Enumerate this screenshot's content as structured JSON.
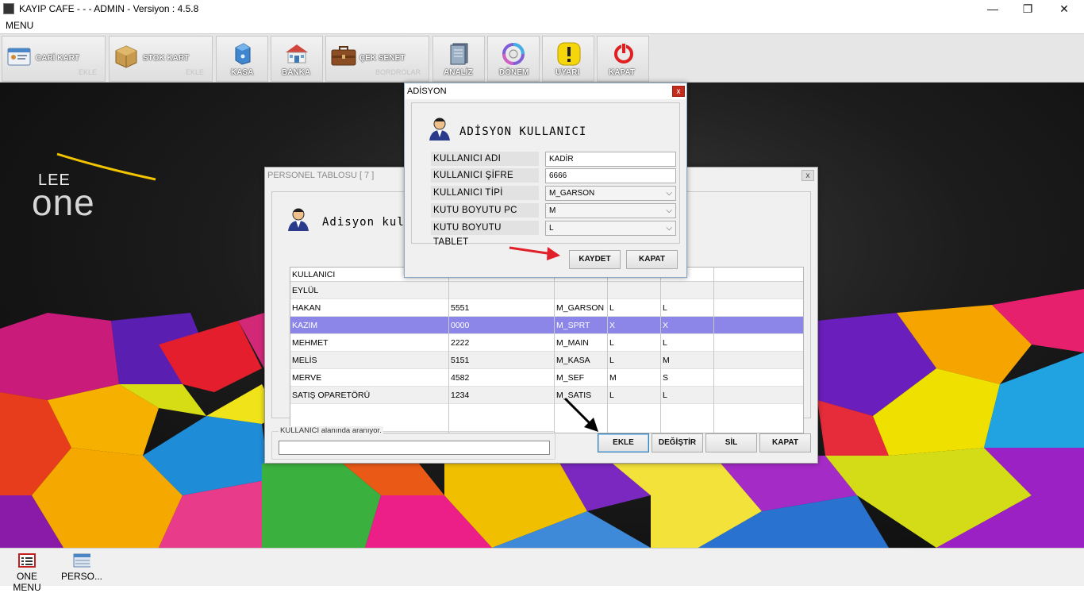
{
  "titlebar": {
    "title": "KAYIP CAFE -  -  - ADMIN -  Versiyon : 4.5.8",
    "minimize": "—",
    "maximize": "❐",
    "close": "✕"
  },
  "menubar": {
    "menu": "MENU"
  },
  "toolbar": {
    "cari_kart": {
      "label": "CARİ KART",
      "sub": "EKLE"
    },
    "stok_kart": {
      "label": "STOK KART",
      "sub": "EKLE"
    },
    "kasa": "KASA",
    "banka": "BANKA",
    "cek_senet": {
      "label": "ÇEK SENET",
      "sub": "BORDROLAR"
    },
    "analiz": "ANALİZ",
    "donem": "DÖNEM",
    "uyari": "UYARI",
    "kapat": "KAPAT"
  },
  "logo": {
    "lee": "LEE",
    "one": "one"
  },
  "personel": {
    "title": "PERSONEL TABLOSU [ 7 ]",
    "close": "x",
    "heading": "Adisyon kull",
    "columns": [
      "KULLANICI",
      "",
      "",
      "",
      "",
      ""
    ],
    "rows": [
      [
        "EYLÜL",
        "",
        "",
        "",
        ""
      ],
      [
        "HAKAN",
        "5551",
        "M_GARSON",
        "L",
        "L"
      ],
      [
        "KAZIM",
        "0000",
        "M_SPRT",
        "X",
        "X"
      ],
      [
        "MEHMET",
        "2222",
        "M_MAIN",
        "L",
        "L"
      ],
      [
        "MELİS",
        "5151",
        "M_KASA",
        "L",
        "M"
      ],
      [
        "MERVE",
        "4582",
        "M_SEF",
        "M",
        "S"
      ],
      [
        "SATIŞ OPARETÖRÜ",
        "1234",
        "M_SATIS",
        "L",
        "L"
      ]
    ],
    "search_label": "KULLANICI alanında aranıyor.",
    "search_value": "",
    "buttons": {
      "ekle": "EKLE",
      "degistir": "DEĞİŞTİR",
      "sil": "SİL",
      "kapat": "KAPAT"
    }
  },
  "adisyon": {
    "title": "ADİSYON",
    "close": "x",
    "heading": "ADİSYON KULLANICI",
    "fields": {
      "kullanici_adi": {
        "label": "KULLANICI ADI",
        "value": "KADİR"
      },
      "kullanici_sifre": {
        "label": "KULLANICI ŞİFRE",
        "value": "6666"
      },
      "kullanici_tipi": {
        "label": "KULLANICI TİPİ",
        "value": "M_GARSON"
      },
      "kutu_pc": {
        "label": "KUTU BOYUTU PC",
        "value": "M"
      },
      "kutu_tablet": {
        "label": "KUTU BOYUTU TABLET",
        "value": "L"
      }
    },
    "buttons": {
      "kaydet": "KAYDET",
      "kapat": "KAPAT"
    }
  },
  "taskbar": {
    "one_menu": "ONE MENU",
    "perso": "PERSO..."
  },
  "colors": {
    "selected_row": "#8b86e8",
    "arrow_red": "#e0202a"
  }
}
